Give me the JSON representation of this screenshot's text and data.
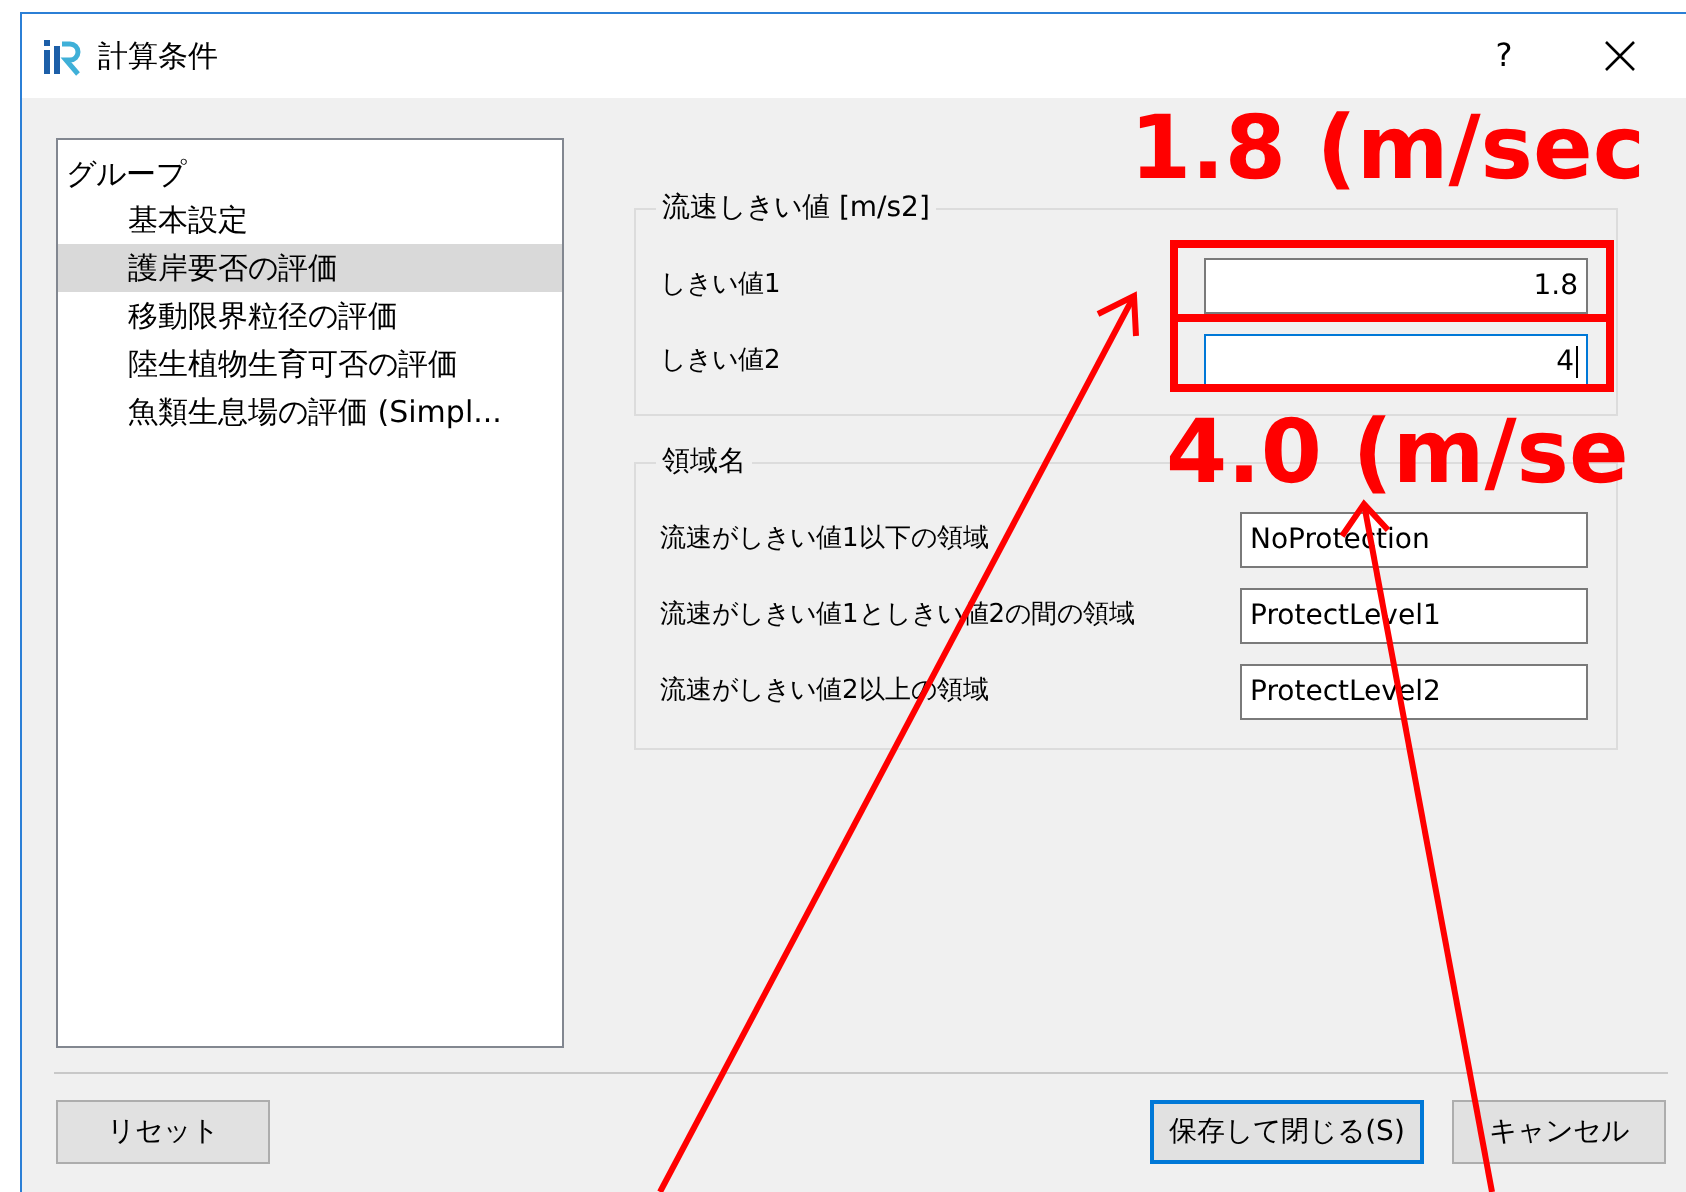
{
  "window": {
    "title": "計算条件",
    "help": "?"
  },
  "tree": {
    "header": "グループ",
    "items": [
      {
        "label": "基本設定",
        "selected": false
      },
      {
        "label": "護岸要否の評価",
        "selected": true
      },
      {
        "label": "移動限界粒径の評価",
        "selected": false
      },
      {
        "label": "陸生植物生育可否の評価",
        "selected": false
      },
      {
        "label": "魚類生息場の評価 (Simpl...",
        "selected": false
      }
    ]
  },
  "groups": [
    {
      "title": "流速しきい値 [m/s2]",
      "kind": "number",
      "fields": [
        {
          "label": "しきい値1",
          "value": "1.8",
          "focused": false
        },
        {
          "label": "しきい値2",
          "value": "4",
          "focused": true
        }
      ]
    },
    {
      "title": "領域名",
      "kind": "text",
      "fields": [
        {
          "label": "流速がしきい値1以下の領域",
          "value": "NoProtection",
          "focused": false
        },
        {
          "label": "流速がしきい値1としきい値2の間の領域",
          "value": "ProtectLevel1",
          "focused": false
        },
        {
          "label": "流速がしきい値2以上の領域",
          "value": "ProtectLevel2",
          "focused": false
        }
      ]
    }
  ],
  "buttons": [
    {
      "label": "リセット",
      "default": false
    },
    {
      "label": "保存して閉じる(S)",
      "default": true
    },
    {
      "label": "キャンセル",
      "default": false
    }
  ],
  "annotations": [
    "1.8 (m/sec",
    "4.0 (m/se"
  ]
}
